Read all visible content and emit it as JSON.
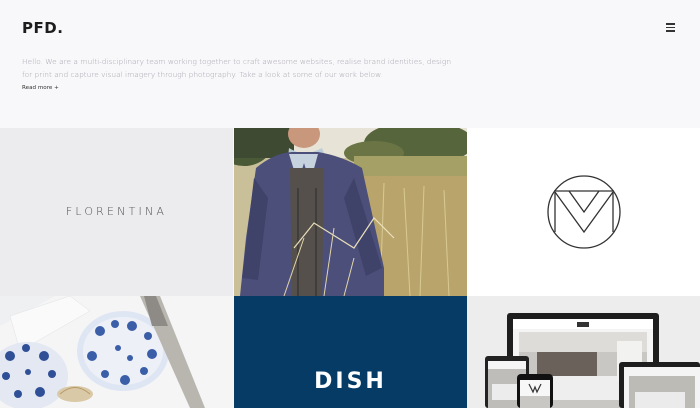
{
  "header": {
    "logo": "PFD.",
    "intro": "Hello. We are a multi-disciplinary team working together to craft awesome websites, realise brand identities, design for print and capture visual imagery through photography. Take a look at some of our work below.",
    "read_more": "Read more +"
  },
  "portfolio": {
    "tiles": [
      {
        "id": "florentina",
        "label": "FLORENTINA"
      },
      {
        "id": "field-photo"
      },
      {
        "id": "monogram-logo"
      },
      {
        "id": "tableware-photo"
      },
      {
        "id": "dish",
        "label": "DISH"
      },
      {
        "id": "responsive-devices"
      }
    ]
  },
  "colors": {
    "background": "#f8f7f9",
    "intro_text": "#a6a4ae",
    "dish_blue": "#063b66"
  },
  "icons": {
    "menu": "hamburger-menu-icon"
  }
}
